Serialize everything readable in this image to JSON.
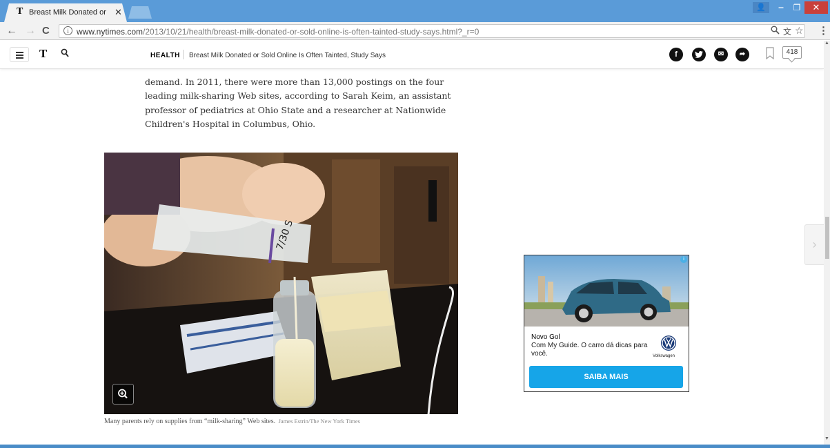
{
  "browser": {
    "tab_title": "Breast Milk Donated or S",
    "tab_close": "✕",
    "url_domain": "www.nytimes.com",
    "url_path": "/2013/10/21/health/breast-milk-donated-or-sold-online-is-often-tainted-study-says.html?_r=0",
    "back": "←",
    "forward": "→",
    "reload": "C",
    "info": "i",
    "zoom_icon": "🔍",
    "translate_icon": "文",
    "star_icon": "☆",
    "menu": "⋮",
    "minimize": "–",
    "maximize": "❐",
    "close": "✕",
    "user": "👤",
    "accent_color": "#5a9bd8"
  },
  "nyt_header": {
    "logo": "T",
    "section": "HEALTH",
    "title": "Breast Milk Donated or Sold Online Is Often Tainted, Study Says",
    "share_facebook": "f",
    "share_twitter": "t",
    "share_email": "✉",
    "share_more": "➦",
    "comment_count": "418"
  },
  "article": {
    "paragraph_clip": "… … … … … … … … … … … …",
    "paragraph": "demand. In 2011, there were more than 13,000 postings on the four leading milk-sharing Web sites, according to Sarah Keim, an assistant professor of pediatrics at Ohio State and a researcher at Nationwide Children's Hospital in Columbus, Ohio.",
    "photo_label": "7/30 S",
    "caption": "Many parents rely on supplies from “milk-sharing” Web sites.",
    "credit": "James Estrin/The New York Times"
  },
  "ad": {
    "title": "Novo Gol",
    "description": "Com My Guide. O carro dá dicas para você.",
    "brand": "Volkswagen",
    "cta": "SAIBA MAIS",
    "choices": "i",
    "cta_color": "#16a5e8"
  },
  "next_arrow": "›"
}
